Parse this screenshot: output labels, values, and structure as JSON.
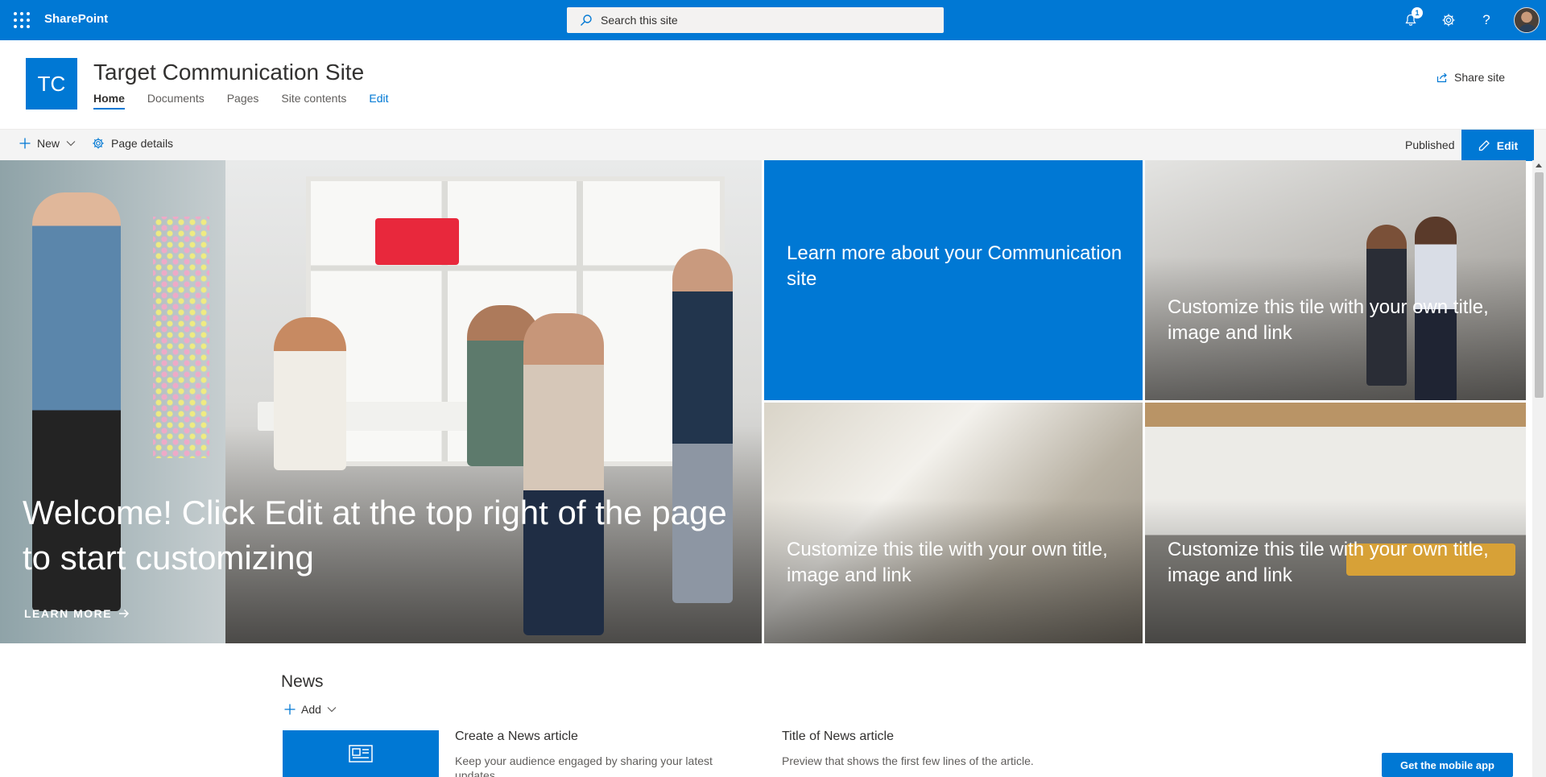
{
  "suite_bar": {
    "app_name": "SharePoint",
    "search_placeholder": "Search this site",
    "notification_count": "1",
    "icons": [
      "app-launcher-icon",
      "search-icon",
      "bell-icon",
      "gear-icon",
      "help-icon",
      "avatar"
    ],
    "background_color": "#0078d4"
  },
  "site": {
    "logo_initials": "TC",
    "title": "Target Communication Site",
    "nav": [
      "Home",
      "Documents",
      "Pages",
      "Site contents",
      "Edit"
    ],
    "active_nav": "Home",
    "share_label": "Share site"
  },
  "command_bar": {
    "new_label": "New",
    "page_details_label": "Page details",
    "status": "Published",
    "edit_label": "Edit"
  },
  "hero": {
    "main_title": "Welcome! Click Edit at the top right of the page to start customizing",
    "learn_more": "LEARN MORE",
    "tiles": [
      "Learn more about your Communication site",
      "Customize this tile with your own title, image and link",
      "Customize this tile with your own title, image and link",
      "Customize this tile with your own title, image and link"
    ]
  },
  "news": {
    "heading": "News",
    "add_label": "Add",
    "items": [
      {
        "title": "Create a News article",
        "description": "Keep your audience engaged by sharing your latest updates"
      },
      {
        "title": "Title of News article",
        "description": "Preview that shows the first few lines of the article."
      }
    ],
    "mobile_app_label": "Get the mobile app"
  },
  "colors": {
    "brand": "#0078d4",
    "command_bar_bg": "#f4f4f4",
    "text": "#323130"
  }
}
